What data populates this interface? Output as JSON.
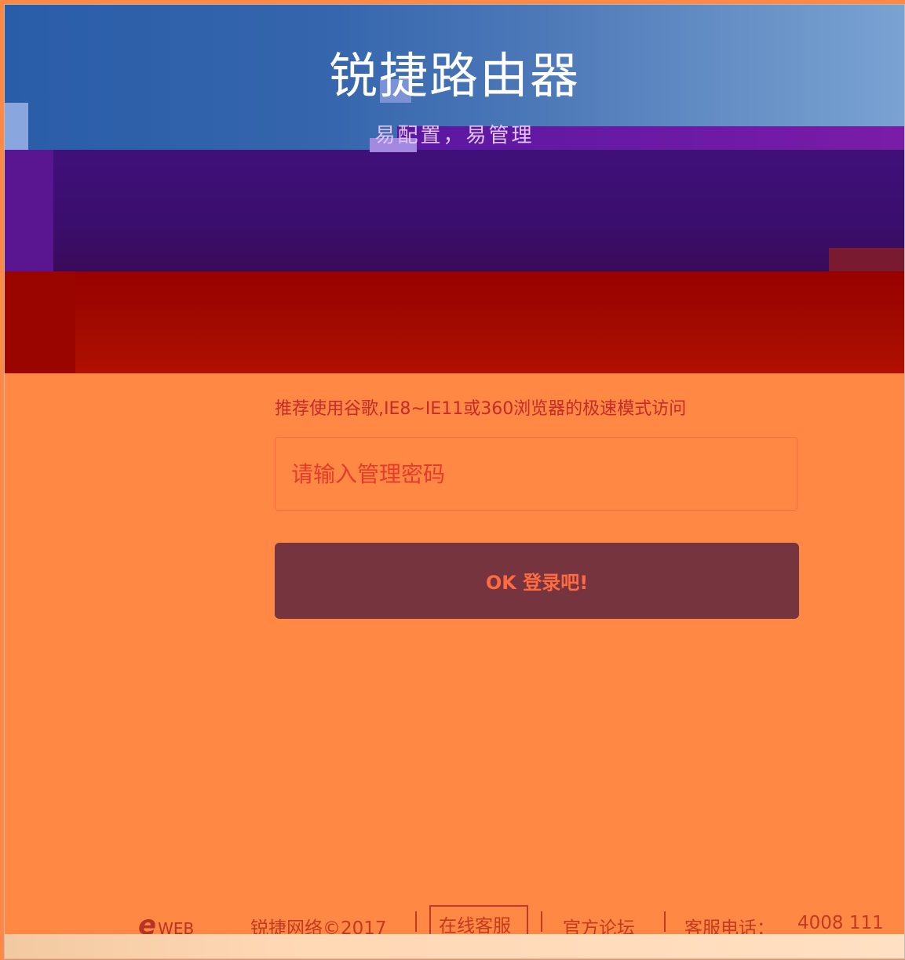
{
  "hero": {
    "title": "锐捷路由器",
    "subtitle": "易配置，易管理"
  },
  "login": {
    "notice": "推荐使用谷歌,IE8~IE11或360浏览器的极速模式访问",
    "password_placeholder": "请输入管理密码",
    "submit_label": "OK 登录吧!"
  },
  "footer": {
    "logo_e": "e",
    "logo_web": "WEB",
    "copyright": "锐捷网络©2017",
    "online_service": "在线客服",
    "forum": "官方论坛",
    "hotline_label": "客服电话：",
    "hotline_number": "4008 111"
  },
  "colors": {
    "page_background": "#ff8844",
    "button_background": "#75343e",
    "accent": "#c62a2a"
  }
}
